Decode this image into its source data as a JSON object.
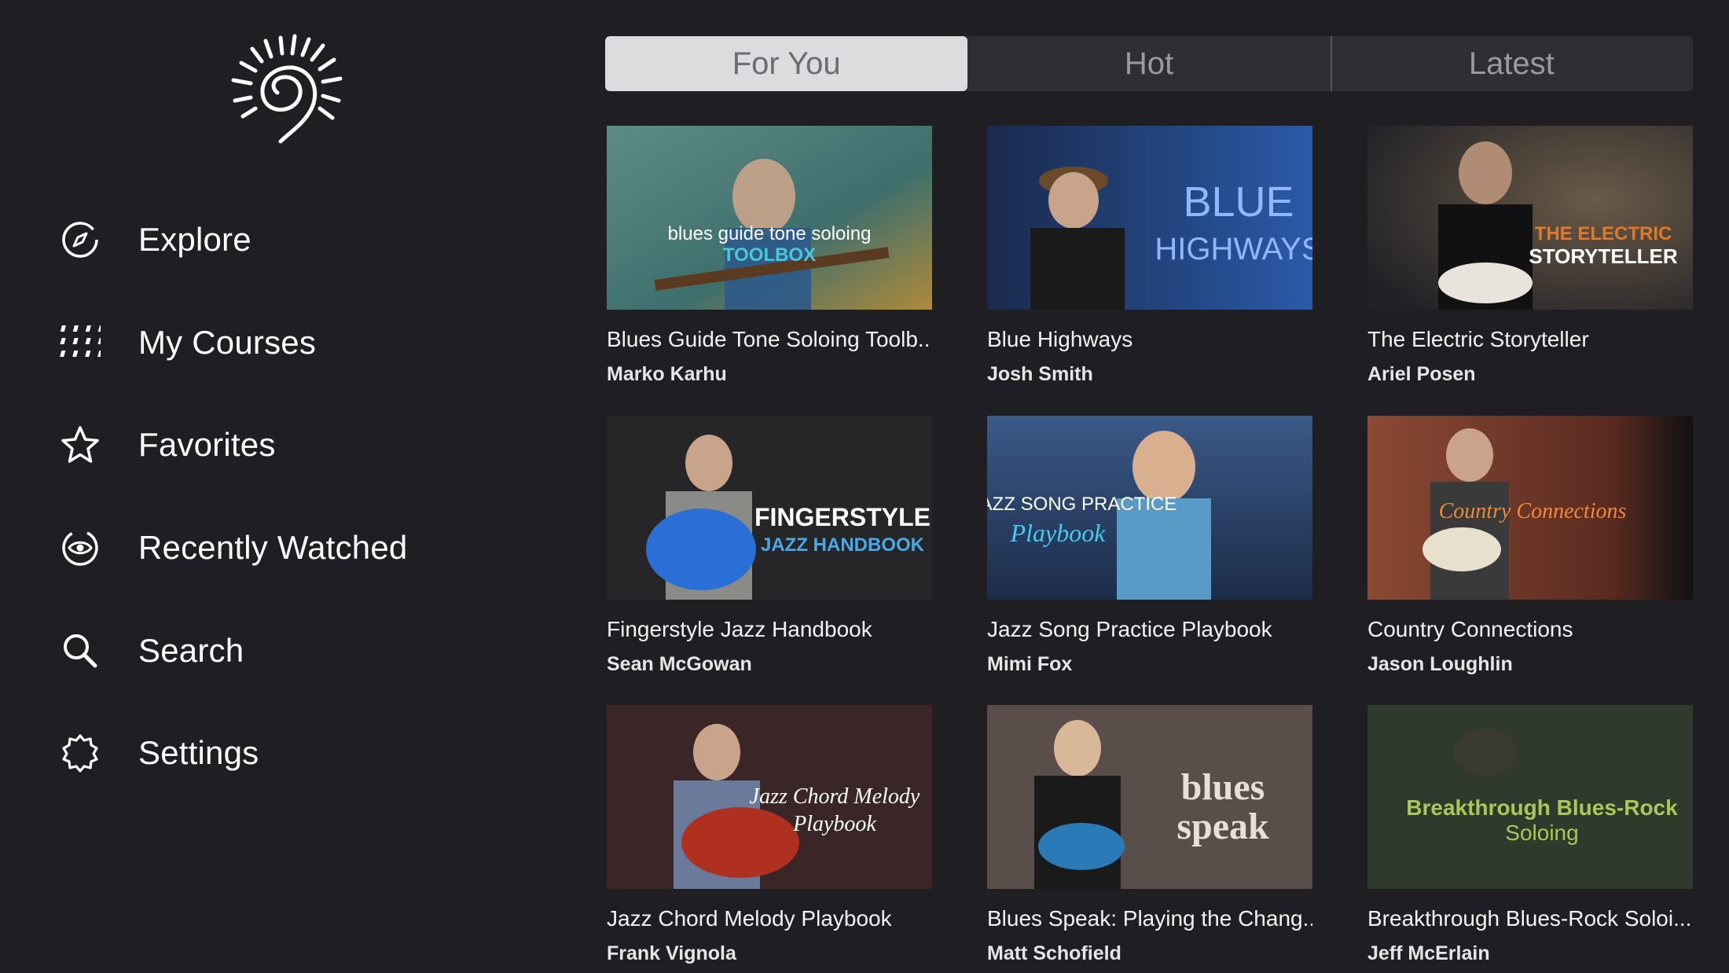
{
  "sidebar": {
    "logo_icon": "sun-spiral-logo",
    "items": [
      {
        "label": "Explore",
        "icon": "compass-icon"
      },
      {
        "label": "My Courses",
        "icon": "grid-dots-icon"
      },
      {
        "label": "Favorites",
        "icon": "star-icon"
      },
      {
        "label": "Recently Watched",
        "icon": "eye-icon"
      },
      {
        "label": "Search",
        "icon": "search-icon"
      },
      {
        "label": "Settings",
        "icon": "gear-icon"
      }
    ]
  },
  "tabs": [
    {
      "label": "For You",
      "active": true
    },
    {
      "label": "Hot",
      "active": false
    },
    {
      "label": "Latest",
      "active": false
    }
  ],
  "courses": [
    {
      "title": "Blues Guide Tone Soloing Toolb...",
      "author": "Marko Karhu",
      "thumb_text": "blues guide tone soloing",
      "thumb_text2": "TOOLBOX",
      "thumb_color": "#4e7d7c"
    },
    {
      "title": "Blue Highways",
      "author": "Josh Smith",
      "thumb_text": "BLUE",
      "thumb_text2": "HIGHWAYS",
      "thumb_color": "#1c3f79"
    },
    {
      "title": "The Electric Storyteller",
      "author": "Ariel Posen",
      "thumb_text": "THE ELECTRIC",
      "thumb_text2": "STORYTELLER",
      "thumb_color": "#3a3a3a"
    },
    {
      "title": "Fingerstyle Jazz Handbook",
      "author": "Sean McGowan",
      "thumb_text": "FINGERSTYLE",
      "thumb_text2": "JAZZ HANDBOOK",
      "thumb_color": "#2a2a2c"
    },
    {
      "title": "Jazz Song Practice Playbook",
      "author": "Mimi Fox",
      "thumb_text": "JAZZ SONG PRACTICE",
      "thumb_text2": "Playbook",
      "thumb_color": "#2e4b6e"
    },
    {
      "title": "Country Connections",
      "author": "Jason Loughlin",
      "thumb_text": "Country Connections",
      "thumb_text2": "",
      "thumb_color": "#7a3b2a"
    },
    {
      "title": "Jazz Chord Melody Playbook",
      "author": "Frank Vignola",
      "thumb_text": "Jazz Chord Melody",
      "thumb_text2": "Playbook",
      "thumb_color": "#3a2626"
    },
    {
      "title": "Blues Speak: Playing the Chang...",
      "author": "Matt Schofield",
      "thumb_text": "blues",
      "thumb_text2": "speak",
      "thumb_color": "#4a3e3a"
    },
    {
      "title": "Breakthrough Blues-Rock Soloi...",
      "author": "Jeff McErlain",
      "thumb_text": "Breakthrough Blues-Rock",
      "thumb_text2": "Soloing",
      "thumb_color": "#2f3a2c"
    }
  ]
}
